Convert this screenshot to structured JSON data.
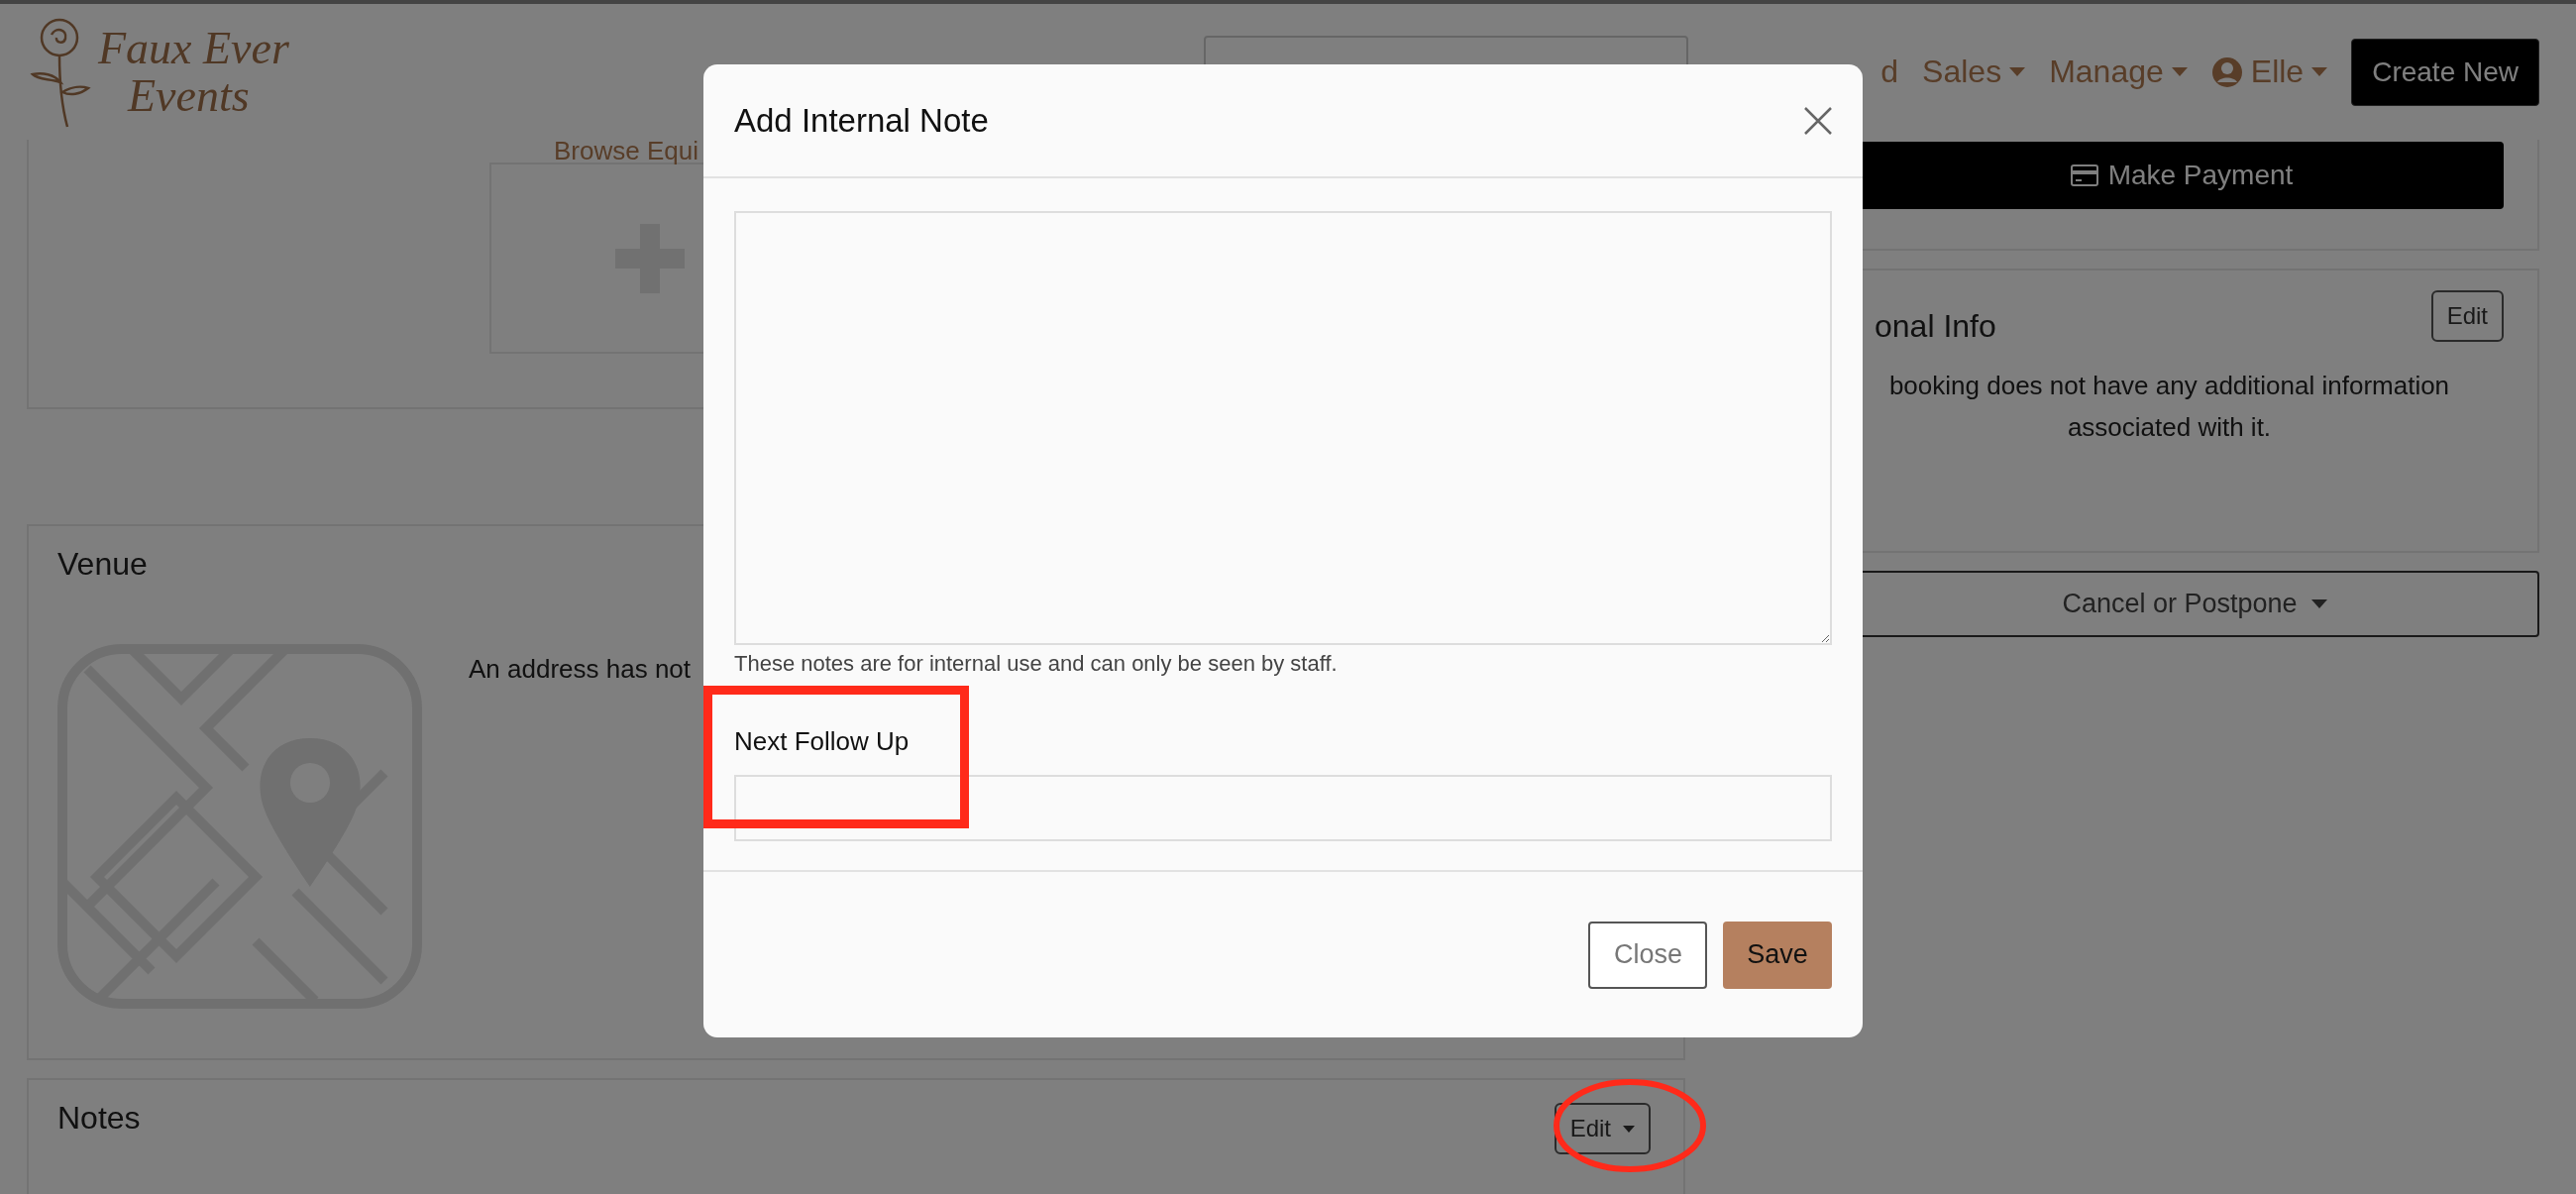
{
  "header": {
    "logo": {
      "line_1": "Faux Ever",
      "line_2": "Events"
    },
    "nav": [
      {
        "label": "d",
        "kind": "link"
      },
      {
        "label": "Sales",
        "kind": "menu"
      },
      {
        "label": "Manage",
        "kind": "menu"
      },
      {
        "label": "Elle",
        "kind": "user"
      }
    ],
    "create_button": "Create New"
  },
  "equipment_card": {
    "browse_label": "Browse Equi"
  },
  "venue_card": {
    "title": "Venue",
    "message": "An address has not"
  },
  "notes_card": {
    "title": "Notes",
    "edit_button": {
      "label": "Edit",
      "highlighted": true
    }
  },
  "payment_button": "Make Payment",
  "info_card": {
    "title": "onal Info",
    "edit_button": "Edit",
    "message_lines": [
      "booking does not have any additional information",
      "associated with it."
    ]
  },
  "cancel_button": "Cancel or Postpone",
  "modal": {
    "title": "Add Internal Note",
    "help_text": "These notes are for internal use and can only be seen by staff.",
    "follow_up": {
      "label": "Next Follow Up",
      "highlighted": true
    },
    "buttons": [
      {
        "label": "Close",
        "kind": "secondary"
      },
      {
        "label": "Save",
        "kind": "primary"
      }
    ]
  }
}
